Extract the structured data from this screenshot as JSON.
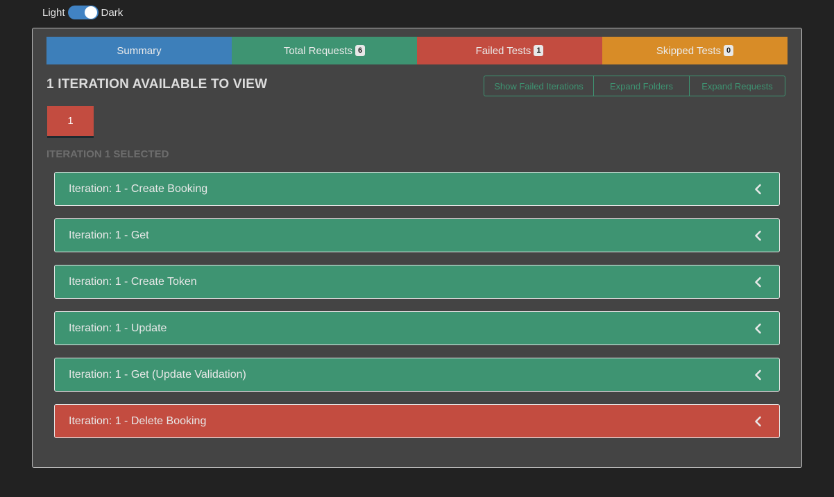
{
  "theme_toggle": {
    "light_label": "Light",
    "dark_label": "Dark",
    "state": "dark"
  },
  "tabs": {
    "summary": {
      "label": "Summary"
    },
    "total_requests": {
      "label": "Total Requests",
      "count": "6"
    },
    "failed_tests": {
      "label": "Failed Tests",
      "count": "1"
    },
    "skipped_tests": {
      "label": "Skipped Tests",
      "count": "0"
    }
  },
  "heading": "1 ITERATION AVAILABLE TO VIEW",
  "actions": {
    "show_failed": "Show Failed Iterations",
    "expand_folders": "Expand Folders",
    "expand_requests": "Expand Requests"
  },
  "iterations": [
    {
      "label": "1",
      "status": "failed",
      "color": "#c34c40"
    }
  ],
  "selected_label": "ITERATION 1 SELECTED",
  "requests": [
    {
      "title": "Iteration: 1 - Create Booking",
      "status": "passed"
    },
    {
      "title": "Iteration: 1 - Get",
      "status": "passed"
    },
    {
      "title": "Iteration: 1 - Create Token",
      "status": "passed"
    },
    {
      "title": "Iteration: 1 - Update",
      "status": "passed"
    },
    {
      "title": "Iteration: 1 - Get (Update Validation)",
      "status": "passed"
    },
    {
      "title": "Iteration: 1 - Delete Booking",
      "status": "failed"
    }
  ],
  "colors": {
    "background": "#222222",
    "panel": "#444444",
    "summary": "#3d7fba",
    "passed": "#3e9472",
    "failed": "#c34c40",
    "skipped": "#d88c27"
  },
  "icons": {
    "row_toggle": "chevron-left-icon"
  }
}
